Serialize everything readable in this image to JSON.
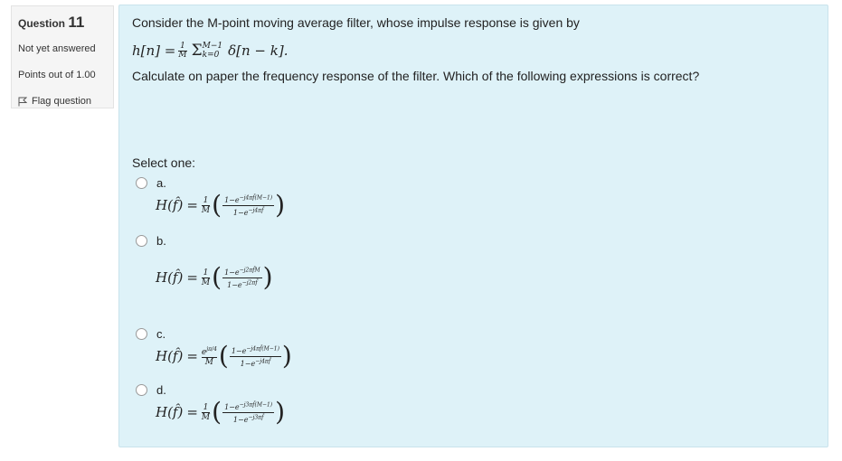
{
  "info": {
    "question_label": "Question",
    "question_number": "11",
    "state": "Not yet answered",
    "grade": "Points out of 1.00",
    "flag_label": "Flag question"
  },
  "question": {
    "intro": "Consider the M-point moving average filter, whose impulse response is given by",
    "eq": {
      "lhs": "h[n] =",
      "frac_num": "1",
      "frac_den": "M",
      "sum": "Σ",
      "upper": "M−1",
      "lower": "k=0",
      "rhs": "δ[n − k]."
    },
    "instruction": "Calculate on paper the frequency response of the filter.  Which of the following expressions is correct?",
    "prompt": "Select one:"
  },
  "options": [
    {
      "letter": "a.",
      "lhs": "H(f̂)",
      "eq": "=",
      "pre_num": "1",
      "pre_den": "M",
      "num": "1−e^{−j4πf̂(M−1)}",
      "den": "1−e^{−j4πf̂}"
    },
    {
      "letter": "b.",
      "lhs": "H(f̂)",
      "eq": "=",
      "pre_num": "1",
      "pre_den": "M",
      "num": "1−e^{−j2πf̂M}",
      "den": "1−e^{−j2πf̂}"
    },
    {
      "letter": "c.",
      "lhs": "H(f̂)",
      "eq": "=",
      "pre_num": "e^{jπ/4}",
      "pre_den": "M",
      "num": "1−e^{−j4πf̂(M−1)}",
      "den": "1−e^{−j4πf̂}"
    },
    {
      "letter": "d.",
      "lhs": "H(f̂)",
      "eq": "=",
      "pre_num": "1",
      "pre_den": "M",
      "num": "1−e^{−j3πf̂(M−1)}",
      "den": "1−e^{−j3πf̂}"
    }
  ]
}
